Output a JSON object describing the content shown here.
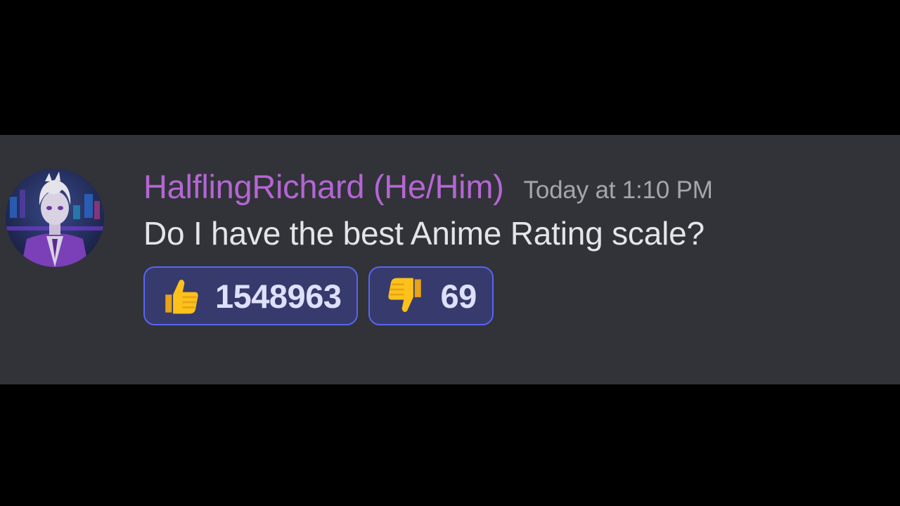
{
  "message": {
    "author": "HalflingRichard (He/Him)",
    "timestamp": "Today at 1:10 PM",
    "text": "Do I have the best Anime Rating scale?",
    "avatar_icon": "anime-character-avatar",
    "author_color": "#b565d4"
  },
  "reactions": [
    {
      "emoji": "thumbs-up-icon",
      "count": "1548963",
      "selected": true
    },
    {
      "emoji": "thumbs-down-icon",
      "count": "69",
      "selected": true
    }
  ],
  "colors": {
    "panel_background": "#313338",
    "reaction_border": "#5865f2",
    "reaction_background": "#373a6c",
    "timestamp": "#a3a6ac",
    "text": "#e3e5e8"
  }
}
